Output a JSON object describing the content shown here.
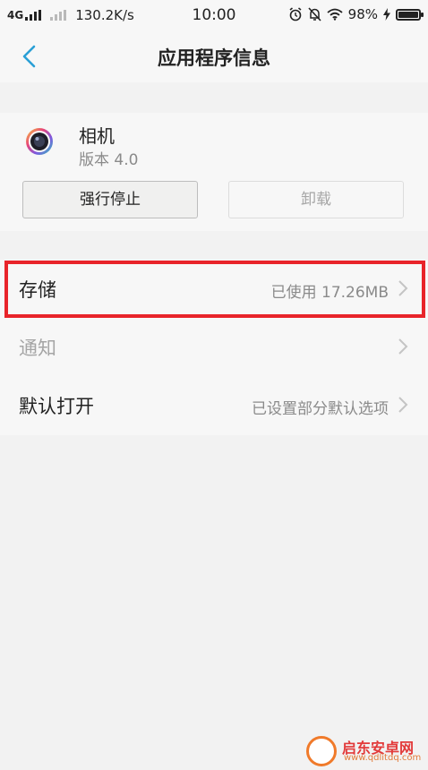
{
  "status_bar": {
    "network": "4G",
    "speed": "130.2K/s",
    "time": "10:00",
    "battery_percent": "98%",
    "battery_level": 0.98,
    "icons": [
      "signal-icon",
      "signal-icon-dim",
      "alarm-icon",
      "mute-icon",
      "wifi-icon",
      "charging-icon",
      "battery-icon"
    ]
  },
  "header": {
    "title": "应用程序信息",
    "back_icon": "back-chevron-icon"
  },
  "app": {
    "name": "相机",
    "version": "版本 4.0",
    "icon": "camera-app-icon",
    "force_stop_label": "强行停止",
    "uninstall_label": "卸载"
  },
  "settings": [
    {
      "label": "存储",
      "value": "已使用 17.26MB",
      "highlighted": true,
      "enabled": true
    },
    {
      "label": "通知",
      "value": "",
      "highlighted": false,
      "enabled": false
    },
    {
      "label": "默认打开",
      "value": "已设置部分默认选项",
      "highlighted": false,
      "enabled": true
    }
  ],
  "colors": {
    "accent": "#2a9fd6",
    "highlight_border": "#e8242a",
    "background": "#f2f2f2",
    "card": "#f7f7f7",
    "muted_text": "#8a8a8a"
  },
  "watermark": {
    "text": "启东安卓网",
    "url": "www.qdlitdq.com"
  }
}
